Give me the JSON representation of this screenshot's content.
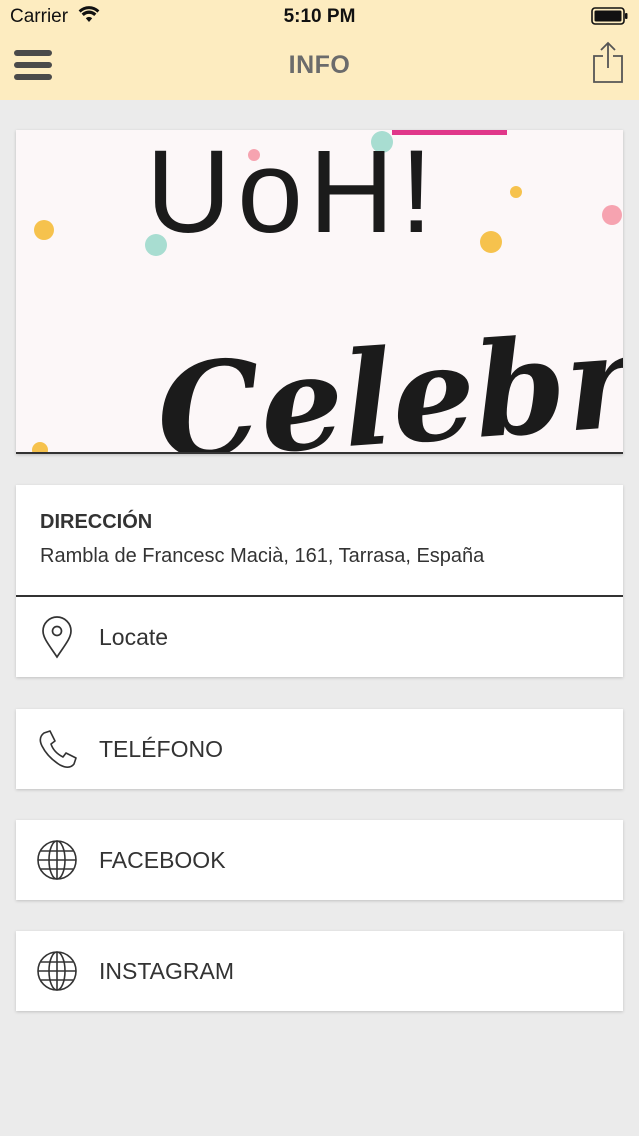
{
  "status_bar": {
    "carrier": "Carrier",
    "time": "5:10 PM"
  },
  "navbar": {
    "title": "INFO",
    "menu_icon": "hamburger-menu-icon",
    "share_icon": "share-icon"
  },
  "hero": {
    "text_top": "UoH!",
    "text_script": "Celebra"
  },
  "address": {
    "label": "DIRECCIÓN",
    "value": "Rambla de Francesc Macià, 161, Tarrasa, España",
    "action_label": "Locate",
    "action_icon": "location-pin-icon"
  },
  "contacts": [
    {
      "label": "TELÉFONO",
      "icon": "phone-icon"
    },
    {
      "label": "FACEBOOK",
      "icon": "globe-icon"
    },
    {
      "label": "INSTAGRAM",
      "icon": "globe-icon"
    }
  ],
  "colors": {
    "header_bg": "#fdecc0",
    "page_bg": "#ebebeb",
    "card_bg": "#ffffff",
    "text": "#333333"
  }
}
